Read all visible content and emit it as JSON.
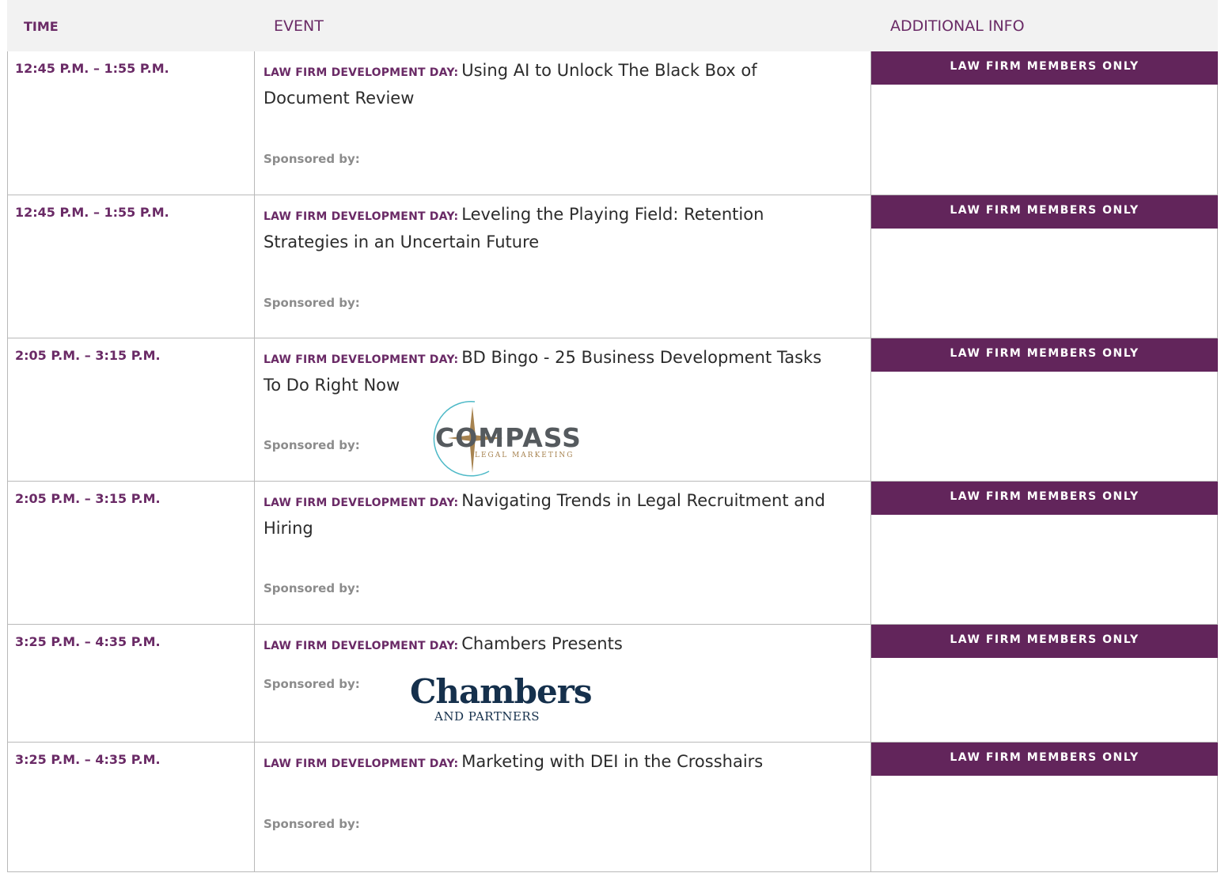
{
  "header": {
    "time": "TIME",
    "event": "EVENT",
    "info": "ADDITIONAL INFO"
  },
  "rows": [
    {
      "time": "12:45 P.M. – 1:55 P.M.",
      "prefix": "LAW FIRM DEVELOPMENT DAY:",
      "title": "Using AI to Unlock The Black Box of Document Review",
      "sponsored": "Sponsored by:",
      "badge": "LAW FIRM MEMBERS ONLY"
    },
    {
      "time": "12:45 P.M. – 1:55 P.M.",
      "prefix": "LAW FIRM DEVELOPMENT DAY:",
      "title": "Leveling the Playing Field: Retention Strategies in an Uncertain Future",
      "sponsored": "Sponsored by:",
      "badge": "LAW FIRM MEMBERS ONLY"
    },
    {
      "time": "2:05 P.M. – 3:15 P.M.",
      "prefix": "LAW FIRM DEVELOPMENT DAY:",
      "title": "BD Bingo - 25 Business Development Tasks To Do Right Now",
      "sponsored": "Sponsored by:",
      "badge": "LAW FIRM MEMBERS ONLY",
      "sponsor_logo": {
        "word": "COMPASS",
        "sub": "LEGAL MARKETING"
      }
    },
    {
      "time": "2:05 P.M. – 3:15 P.M.",
      "prefix": "LAW FIRM DEVELOPMENT DAY:",
      "title": "Navigating Trends in Legal Recruitment and Hiring",
      "sponsored": "Sponsored by:",
      "badge": "LAW FIRM MEMBERS ONLY"
    },
    {
      "time": "3:25 P.M. – 4:35 P.M.",
      "prefix": "LAW FIRM DEVELOPMENT DAY:",
      "title": "Chambers Presents",
      "sponsored": "Sponsored by:",
      "badge": "LAW FIRM MEMBERS ONLY",
      "sponsor_logo": {
        "word": "Chambers",
        "sub": "AND PARTNERS"
      }
    },
    {
      "time": "3:25 P.M. – 4:35 P.M.",
      "prefix": "LAW FIRM DEVELOPMENT DAY:",
      "title": "Marketing with DEI in the Crosshairs",
      "sponsored": "Sponsored by:",
      "badge": "LAW FIRM MEMBERS ONLY"
    }
  ],
  "colors": {
    "accent": "#6a2a66",
    "badge_bg": "#62255b",
    "header_bg": "#f2f2f2",
    "border": "#b9b9b9",
    "muted_text": "#8c8c8c"
  }
}
